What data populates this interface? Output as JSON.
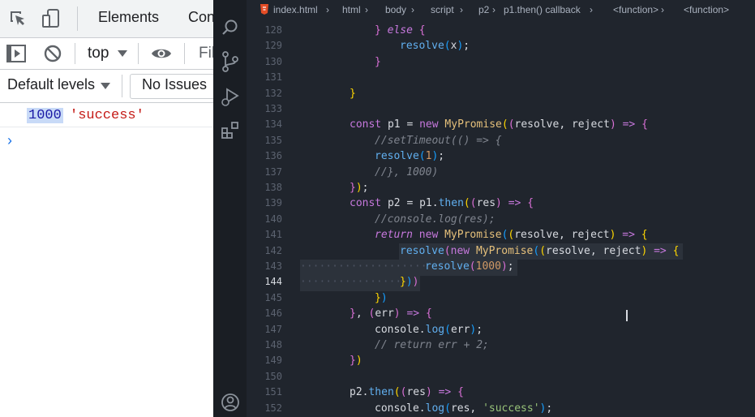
{
  "devtools": {
    "tabs": [
      "Elements",
      "Con"
    ],
    "context": "top",
    "filter_placeholder": "Fil",
    "levels_label": "Default levels",
    "issues_label": "No Issues",
    "console_output": {
      "number": "1000",
      "string": "'success'"
    },
    "prompt_symbol": "›"
  },
  "editor": {
    "breadcrumbs": [
      "index.html",
      "html",
      "body",
      "script",
      "p2",
      "p1.then() callback",
      "<function>",
      "<function>"
    ],
    "active_line": 144,
    "lines": [
      {
        "n": 128,
        "text": "} else {"
      },
      {
        "n": 129,
        "text": "resolve(x);"
      },
      {
        "n": 130,
        "text": "}"
      },
      {
        "n": 131,
        "text": ""
      },
      {
        "n": 132,
        "text": "}"
      },
      {
        "n": 133,
        "text": ""
      },
      {
        "n": 134,
        "text": "const p1 = new MyPromise((resolve, reject) => {"
      },
      {
        "n": 135,
        "text": "//setTimeout(() => {"
      },
      {
        "n": 136,
        "text": "resolve(1);"
      },
      {
        "n": 137,
        "text": "//}, 1000)"
      },
      {
        "n": 138,
        "text": "});"
      },
      {
        "n": 139,
        "text": "const p2 = p1.then((res) => {"
      },
      {
        "n": 140,
        "text": "//console.log(res);"
      },
      {
        "n": 141,
        "text": "return new MyPromise((resolve, reject) => {"
      },
      {
        "n": 142,
        "text": "resolve(new MyPromise((resolve, reject) => {"
      },
      {
        "n": 143,
        "text": "resolve(1000);"
      },
      {
        "n": 144,
        "text": "}))"
      },
      {
        "n": 145,
        "text": "})"
      },
      {
        "n": 146,
        "text": "}, (err) => {"
      },
      {
        "n": 147,
        "text": "console.log(err);"
      },
      {
        "n": 148,
        "text": "// return err + 2;"
      },
      {
        "n": 149,
        "text": "})"
      },
      {
        "n": 150,
        "text": ""
      },
      {
        "n": 151,
        "text": "p2.then((res) => {"
      },
      {
        "n": 152,
        "text": "console.log(res, 'success');"
      }
    ]
  },
  "colors": {
    "editor_bg": "#20252d",
    "keyword": "#c678dd",
    "function": "#61afef",
    "class": "#e5c07b",
    "number": "#d19a66",
    "string": "#98c379",
    "comment": "#7f848e",
    "console_number": "#1a1aa6",
    "console_string": "#c41a16"
  },
  "icons": [
    "inspect-icon",
    "device-toggle-icon",
    "sidebar-toggle-icon",
    "clear-console-icon",
    "dropdown-arrow-icon",
    "eye-icon",
    "search-icon",
    "source-control-icon",
    "run-debug-icon",
    "extensions-icon",
    "account-icon",
    "html-file-icon"
  ]
}
